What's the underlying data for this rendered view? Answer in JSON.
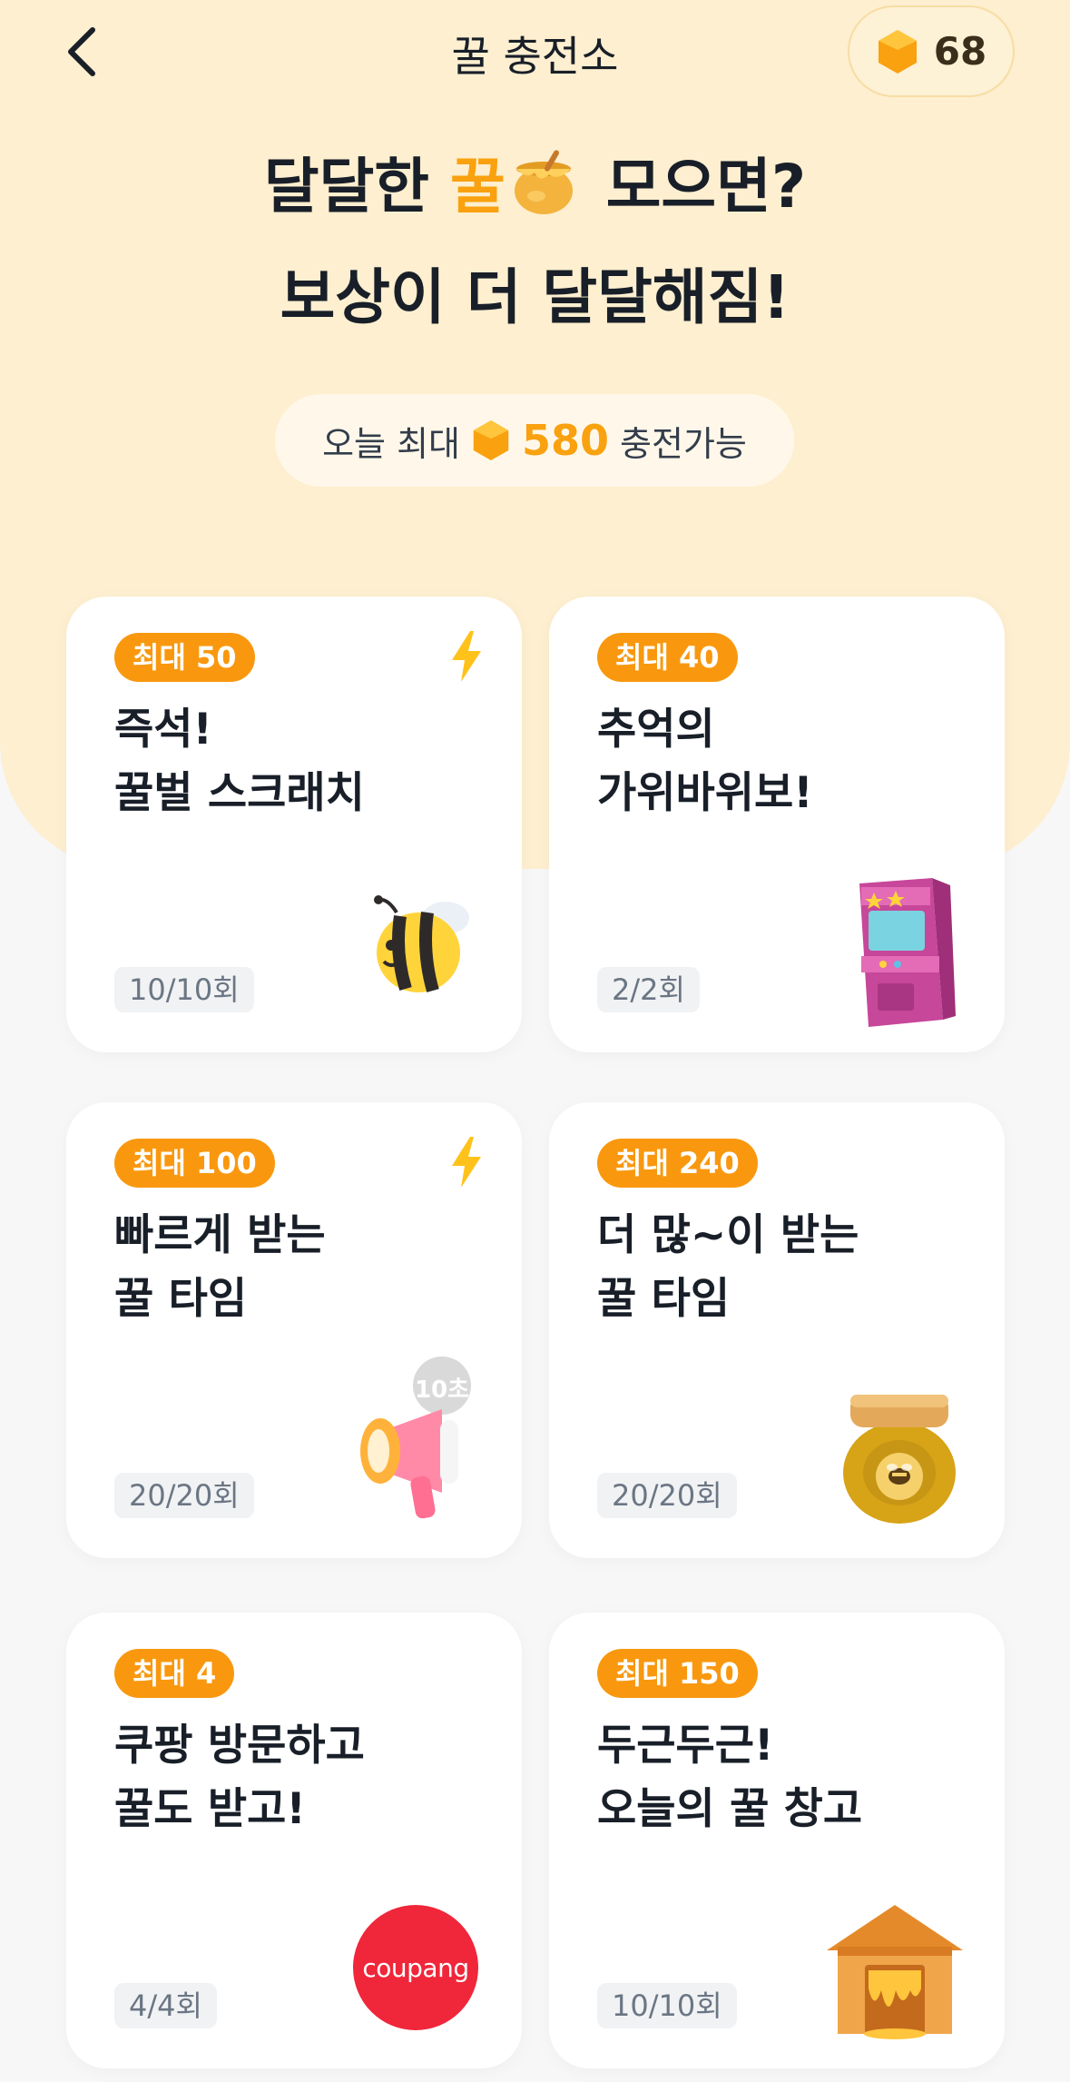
{
  "header": {
    "title": "꿀 충전소",
    "coin_balance": "68"
  },
  "hero": {
    "line1_before": "달달한 ",
    "line1_highlight": "꿀",
    "line1_after": " 모으면?",
    "line2": "보상이 더 달달해짐!",
    "today_prefix": "오늘 최대",
    "today_value": "580",
    "today_suffix": "충전가능"
  },
  "colors": {
    "accent": "#f9a10f",
    "badge": "#f9980f",
    "hero_bg": "#fdefcf",
    "bolt": "#ffc21a",
    "coupang_red": "#f0263a"
  },
  "cards": [
    {
      "badge": "최대 50",
      "title": "즉석!\n꿀벌 스크래치",
      "count": "10/10회",
      "bolt": true,
      "art": "bee-icon"
    },
    {
      "badge": "최대 40",
      "title": "추억의\n가위바위보!",
      "count": "2/2회",
      "bolt": false,
      "art": "arcade-machine-icon"
    },
    {
      "badge": "최대 100",
      "title": "빠르게 받는\n꿀 타임",
      "count": "20/20회",
      "bolt": true,
      "art": "megaphone-icon",
      "art_label": "10초"
    },
    {
      "badge": "최대 240",
      "title": "더 많~이 받는\n꿀 타임",
      "count": "20/20회",
      "bolt": false,
      "art": "honey-jar-icon"
    },
    {
      "badge": "최대 4",
      "title": "쿠팡 방문하고\n꿀도 받고!",
      "count": "4/4회",
      "bolt": false,
      "art": "coupang-logo",
      "art_label": "coupang"
    },
    {
      "badge": "최대 150",
      "title": "두근두근!\n오늘의 꿀 창고",
      "count": "10/10회",
      "bolt": false,
      "art": "honey-warehouse-icon"
    }
  ]
}
